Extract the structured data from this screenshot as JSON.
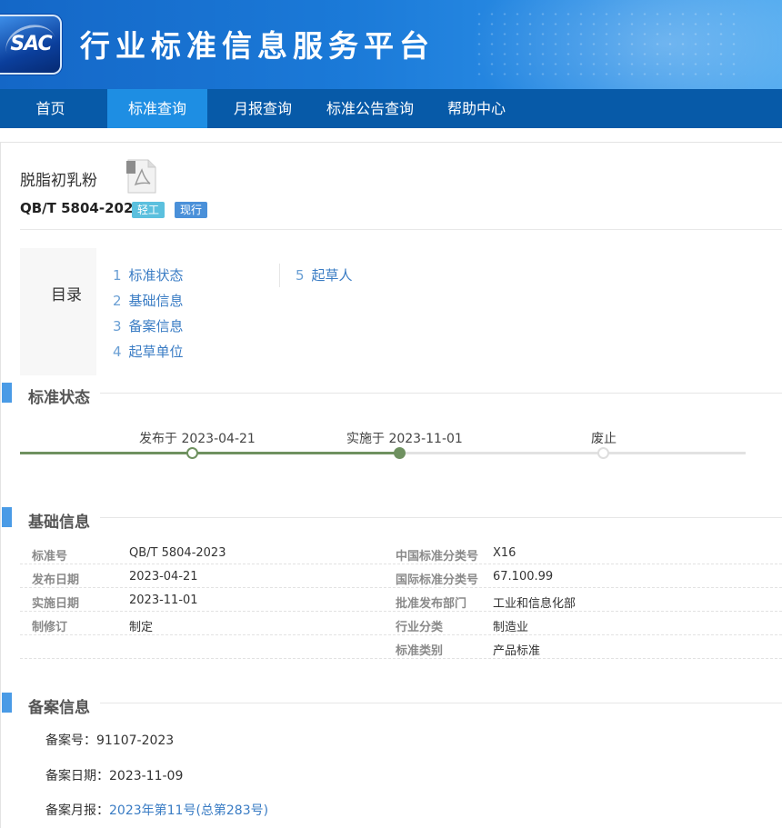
{
  "header": {
    "logo_text": "SAC",
    "site_title": "行业标准信息服务平台"
  },
  "nav": {
    "items": [
      {
        "label": "首页"
      },
      {
        "label": "标准查询"
      },
      {
        "label": "月报查询"
      },
      {
        "label": "标准公告查询"
      },
      {
        "label": "帮助中心"
      }
    ],
    "active_index": 1
  },
  "standard": {
    "name": "脱脂初乳粉",
    "code": "QB/T 5804-2023",
    "tags": [
      "轻工",
      "现行"
    ],
    "file_icon": "pdf-file-icon"
  },
  "toc": {
    "title": "目录",
    "items": [
      {
        "num": "1",
        "label": "标准状态"
      },
      {
        "num": "2",
        "label": "基础信息"
      },
      {
        "num": "3",
        "label": "备案信息"
      },
      {
        "num": "4",
        "label": "起草单位"
      },
      {
        "num": "5",
        "label": "起草人"
      }
    ]
  },
  "status": {
    "section_title": "标准状态",
    "steps": [
      {
        "label": "发布于 2023-04-21"
      },
      {
        "label": "实施于 2023-11-01"
      },
      {
        "label": "废止"
      }
    ]
  },
  "basic": {
    "section_title": "基础信息",
    "rows": [
      {
        "l1": "标准号",
        "v1": "QB/T 5804-2023",
        "l2": "中国标准分类号",
        "v2": "X16"
      },
      {
        "l1": "发布日期",
        "v1": "2023-04-21",
        "l2": "国际标准分类号",
        "v2": "67.100.99"
      },
      {
        "l1": "实施日期",
        "v1": "2023-11-01",
        "l2": "批准发布部门",
        "v2": "工业和信息化部"
      },
      {
        "l1": "制修订",
        "v1": "制定",
        "l2": "行业分类",
        "v2": "制造业"
      },
      {
        "l1": "",
        "v1": "",
        "l2": "标准类别",
        "v2": "产品标准"
      }
    ]
  },
  "filing": {
    "section_title": "备案信息",
    "number_label": "备案号：",
    "number_value": "91107-2023",
    "date_label": "备案日期：",
    "date_value": "2023-11-09",
    "report_label": "备案月报：",
    "report_link": "2023年第11号(总第283号)"
  },
  "colors": {
    "nav_bg": "#075aa8",
    "nav_active": "#1e8ee3",
    "accent_bar": "#4a9be6",
    "timeline_done": "#6f9160",
    "link": "#3a7cc4"
  }
}
